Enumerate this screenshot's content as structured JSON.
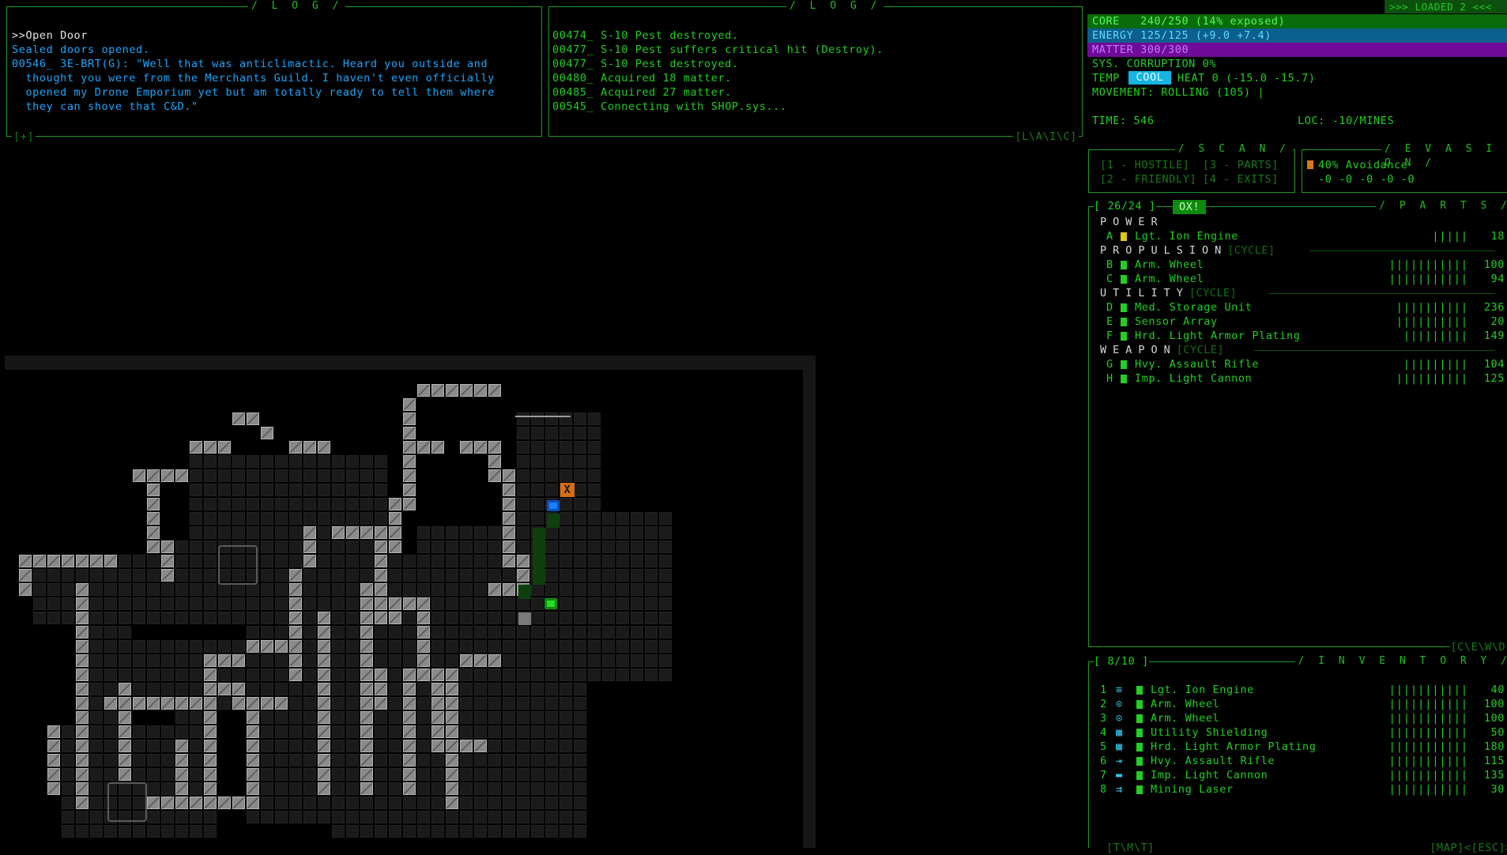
{
  "log_left": {
    "title": "/ L O G /",
    "footer": "[+]",
    "lines": [
      {
        "text": ">>Open Door",
        "cls": "white"
      },
      {
        "text": "Sealed doors opened.",
        "cls": "blue"
      },
      {
        "text": "00546_ 3E-BRT(G): \"Well that was anticlimactic. Heard you outside and",
        "cls": "blue"
      },
      {
        "text": "  thought you were from the Merchants Guild. I haven't even officially",
        "cls": "blue"
      },
      {
        "text": "  opened my Drone Emporium yet but am totally ready to tell them where",
        "cls": "blue"
      },
      {
        "text": "  they can shove that C&D.\"",
        "cls": "blue"
      }
    ]
  },
  "log_right": {
    "title": "/ L O G /",
    "footer": "[L\\A\\I\\C]",
    "lines": [
      "00474_ S-10 Pest destroyed.",
      "00477_ S-10 Pest suffers critical hit (Destroy).",
      "00477_ S-10 Pest destroyed.",
      "00480_ Acquired 18 matter.",
      "00485_ Acquired 27 matter.",
      "00545_ Connecting with SHOP.sys..."
    ]
  },
  "loaded_banner": ">>> LOADED 2 <<<",
  "status": {
    "core": "CORE   240/250 (14% exposed)",
    "energy": "ENERGY 125/125 (+9.0 +7.4)",
    "matter": "MATTER 300/300",
    "corruption": "SYS. CORRUPTION 0%",
    "temp_label": "TEMP",
    "temp_value": "COOL",
    "heat": "HEAT 0 (-15.0 -15.7)",
    "movement": "MOVEMENT: ROLLING (105) |",
    "time": "TIME: 546",
    "loc": "LOC: -10/MINES",
    "colors": {
      "core": "#0a6b0a",
      "energy": "#0a5f8c",
      "matter": "#6f0a9a",
      "temp": "#16b4e0"
    }
  },
  "scan": {
    "title": "/ S C A N /",
    "items": [
      "[1 - HOSTILE]",
      "[3 - PARTS]",
      "[2 - FRIENDLY]",
      "[4 - EXITS]"
    ]
  },
  "evasion": {
    "title": "/ E V A S I O N /",
    "avoidance": "40% Avoidance",
    "values": "-0 -0 -0 -0 -0"
  },
  "parts": {
    "title": "/ P A R T S /",
    "slots": "[ 26/24 ]",
    "tab": "OX!",
    "footer": "[C\\E\\W\\D]",
    "sections": [
      {
        "name": "POWER",
        "cycle": "",
        "items": [
          {
            "key": "A",
            "name": "Lgt. Ion Engine",
            "bar": "|||||",
            "val": "18",
            "color": "yellow"
          }
        ]
      },
      {
        "name": "PROPULSION",
        "cycle": "[CYCLE]",
        "items": [
          {
            "key": "B",
            "name": "Arm. Wheel",
            "bar": "|||||||||||",
            "val": "100",
            "color": "green"
          },
          {
            "key": "C",
            "name": "Arm. Wheel",
            "bar": "|||||||||||",
            "val": "94",
            "color": "green"
          }
        ]
      },
      {
        "name": "UTILITY",
        "cycle": "[CYCLE]",
        "items": [
          {
            "key": "D",
            "name": "Med. Storage Unit",
            "bar": "||||||||||",
            "val": "236",
            "color": "green"
          },
          {
            "key": "E",
            "name": "Sensor Array",
            "bar": "||||||||||",
            "val": "20",
            "color": "green"
          },
          {
            "key": "F",
            "name": "Hrd. Light Armor Plating",
            "bar": "|||||||||",
            "val": "149",
            "color": "green"
          }
        ]
      },
      {
        "name": "WEAPON",
        "cycle": "[CYCLE]",
        "items": [
          {
            "key": "G",
            "name": "Hvy. Assault Rifle",
            "bar": "|||||||||",
            "val": "104",
            "color": "green"
          },
          {
            "key": "H",
            "name": "Imp. Light Cannon",
            "bar": "||||||||||",
            "val": "125",
            "color": "green"
          }
        ]
      }
    ]
  },
  "inventory": {
    "title": "/ I N V E N T O R Y /",
    "slots": "[ 8/10 ]",
    "footer_left": "[T\\M\\T]",
    "footer_right": "[MAP]<[ESC]>",
    "items": [
      {
        "key": "1",
        "icon": "engine-icon",
        "glyph": "≡",
        "name": "Lgt. Ion Engine",
        "bar": "|||||||||||",
        "val": "40"
      },
      {
        "key": "2",
        "icon": "wheel-icon",
        "glyph": "⊙",
        "name": "Arm. Wheel",
        "bar": "|||||||||||",
        "val": "100"
      },
      {
        "key": "3",
        "icon": "wheel-icon",
        "glyph": "⊙",
        "name": "Arm. Wheel",
        "bar": "|||||||||||",
        "val": "100"
      },
      {
        "key": "4",
        "icon": "shield-icon",
        "glyph": "▦",
        "name": "Utility Shielding",
        "bar": "|||||||||||",
        "val": "50"
      },
      {
        "key": "5",
        "icon": "armor-icon",
        "glyph": "▦",
        "name": "Hrd. Light Armor Plating",
        "bar": "|||||||||||",
        "val": "180"
      },
      {
        "key": "6",
        "icon": "rifle-icon",
        "glyph": "⇥",
        "name": "Hvy. Assault Rifle",
        "bar": "|||||||||||",
        "val": "115"
      },
      {
        "key": "7",
        "icon": "cannon-icon",
        "glyph": "▬",
        "name": "Imp. Light Cannon",
        "bar": "|||||||||||",
        "val": "135"
      },
      {
        "key": "8",
        "icon": "laser-icon",
        "glyph": "⇉",
        "name": "Mining Laser",
        "bar": "|||||||||||",
        "val": "30"
      }
    ]
  },
  "map": {
    "marker_x_label": "X"
  }
}
